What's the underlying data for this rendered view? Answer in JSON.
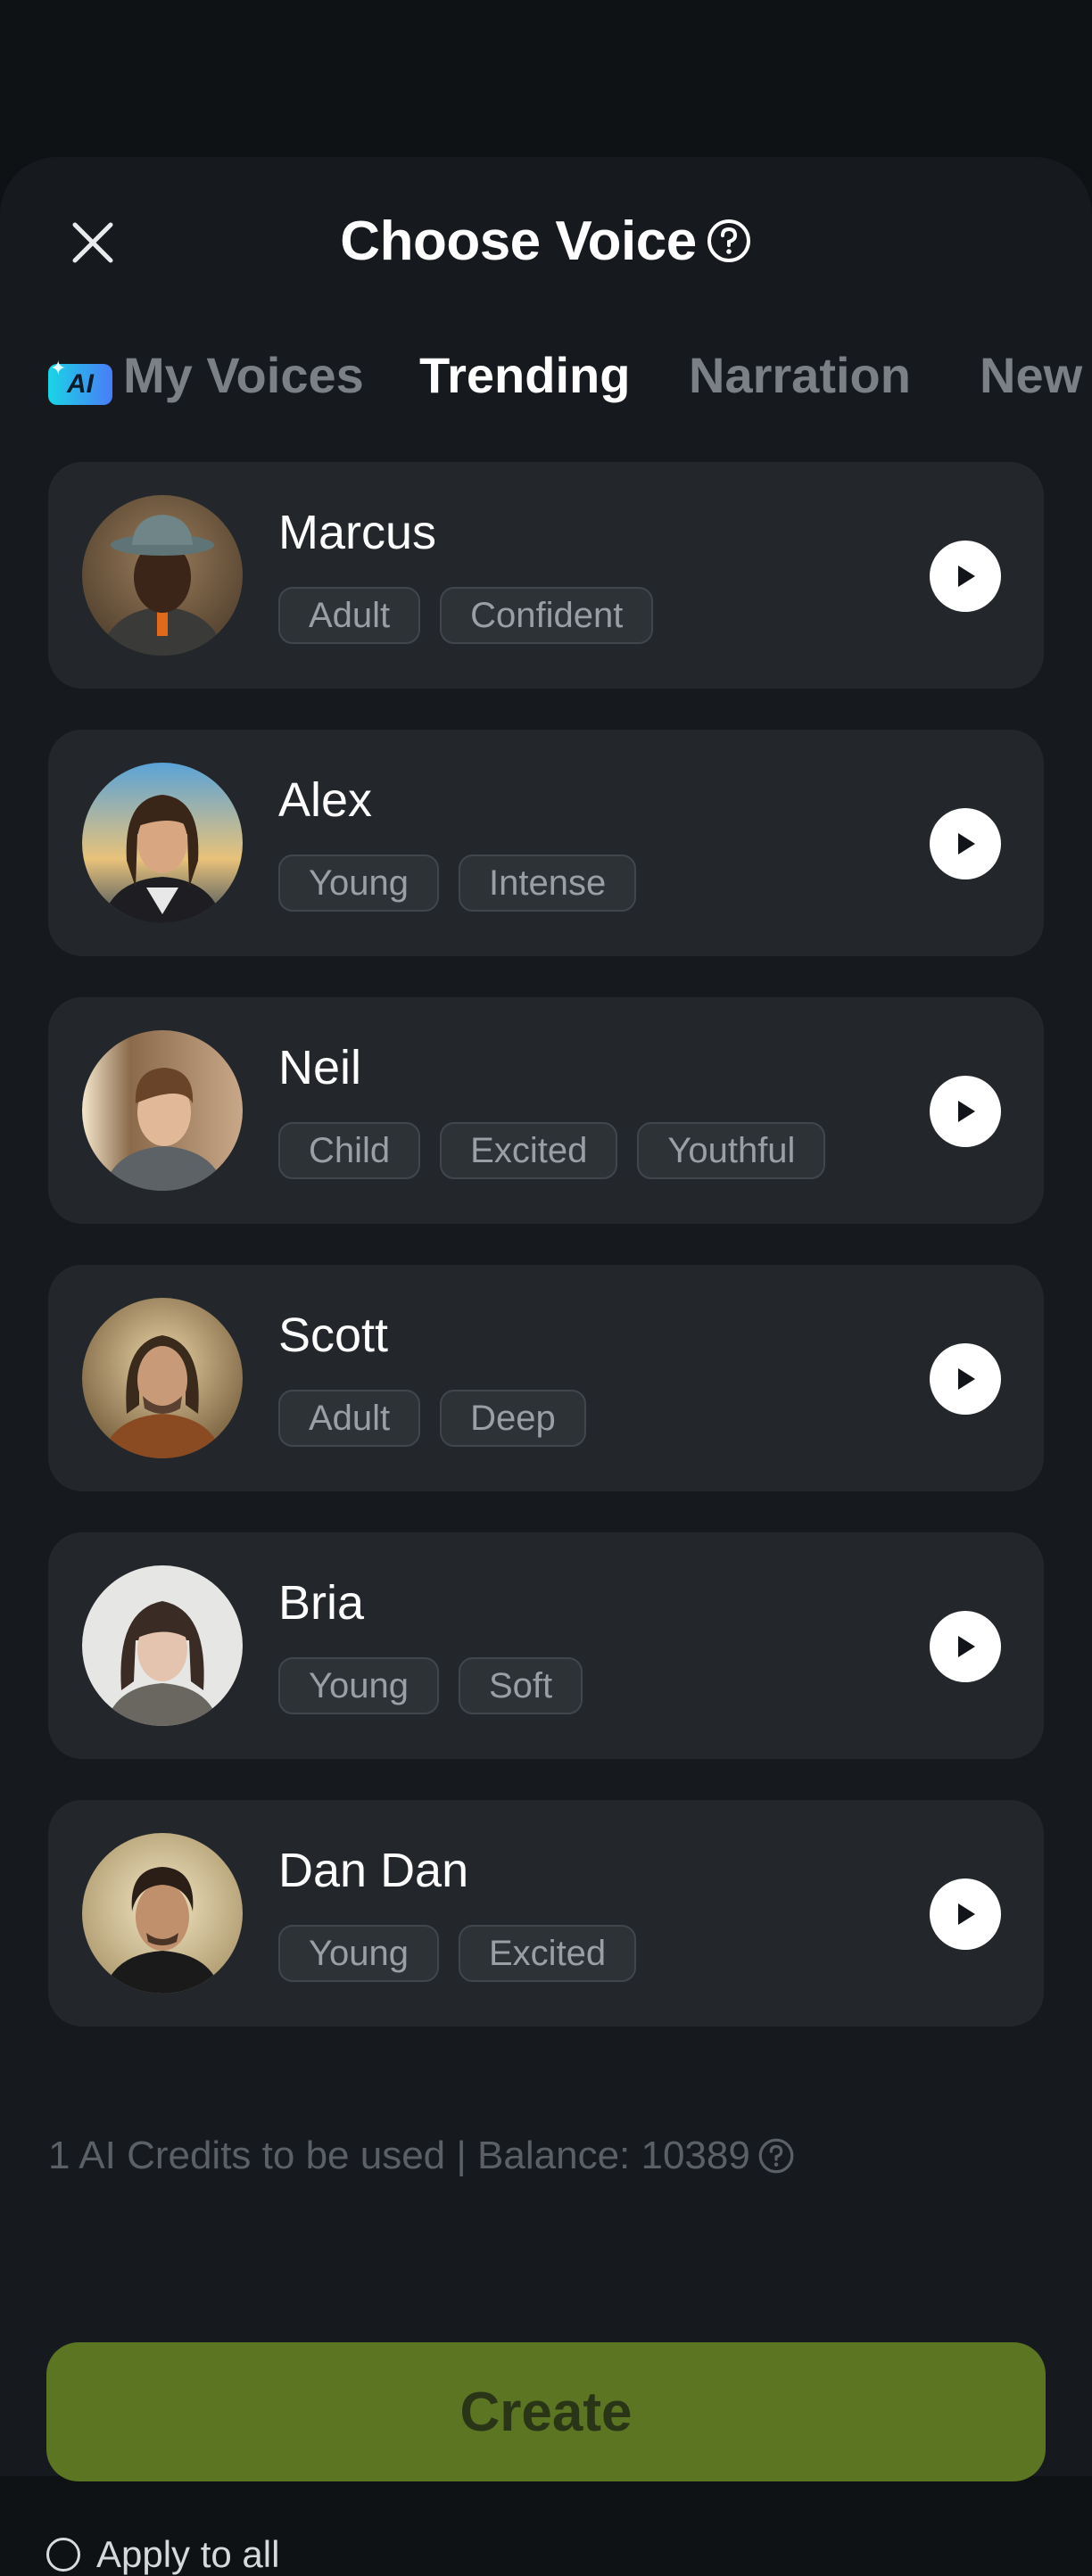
{
  "header": {
    "title": "Choose Voice"
  },
  "tabs": [
    {
      "label": "My Voices",
      "badge": "AI"
    },
    {
      "label": "Trending"
    },
    {
      "label": "Narration"
    },
    {
      "label": "New"
    }
  ],
  "active_tab": "Trending",
  "voices": [
    {
      "name": "Marcus",
      "tags": [
        "Adult",
        "Confident"
      ]
    },
    {
      "name": "Alex",
      "tags": [
        "Young",
        "Intense"
      ]
    },
    {
      "name": "Neil",
      "tags": [
        "Child",
        "Excited",
        "Youthful"
      ]
    },
    {
      "name": "Scott",
      "tags": [
        "Adult",
        "Deep"
      ]
    },
    {
      "name": "Bria",
      "tags": [
        "Young",
        "Soft"
      ]
    },
    {
      "name": "Dan Dan",
      "tags": [
        "Young",
        "Excited"
      ]
    }
  ],
  "footer": {
    "credits_text": "1 AI Credits to be used | Balance: 10389",
    "create_label": "Create",
    "apply_label": "Apply to all",
    "apply_checked": false
  },
  "colors": {
    "background": "#0f1215",
    "sheet": "#16191d",
    "card": "#23272c",
    "accent_button": "#5b7522",
    "tab_inactive": "#7b8087"
  }
}
